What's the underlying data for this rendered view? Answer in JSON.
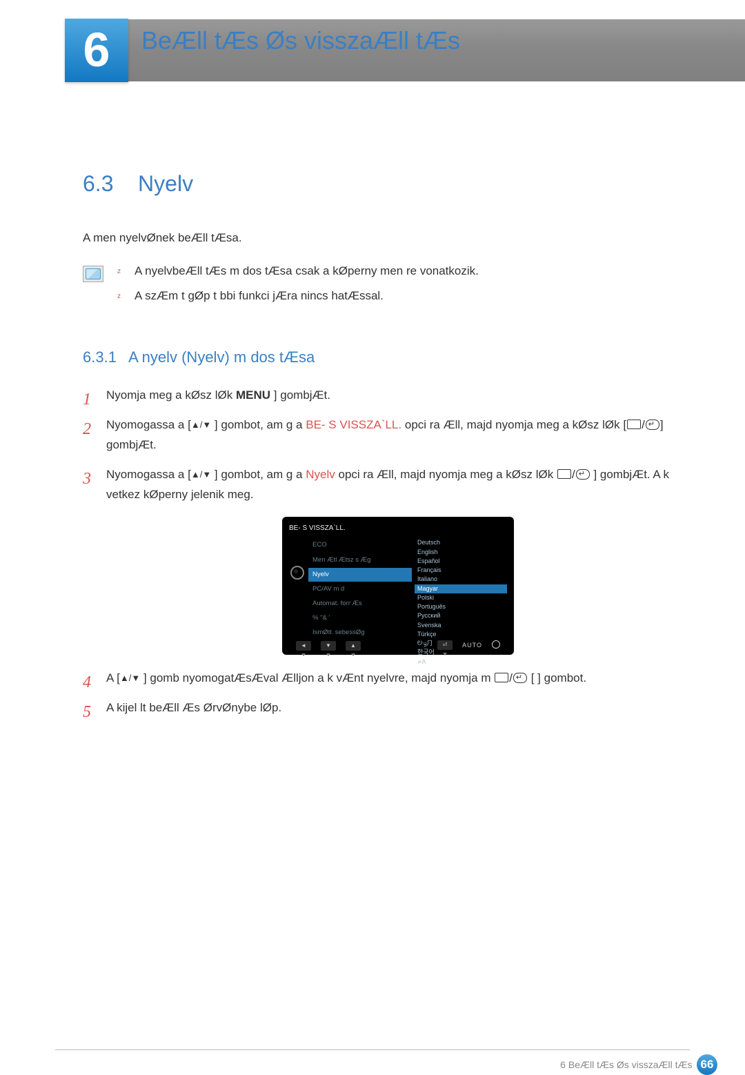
{
  "chapter": {
    "number": "6",
    "title": "BeÆll tÆs Øs visszaÆll tÆs"
  },
  "section": {
    "number": "6.3",
    "title": "Nyelv",
    "intro": "A men  nyelvØnek beÆll tÆsa.",
    "notes": [
      "A nyelvbeÆll tÆs m dos tÆsa csak a kØperny men re vonatkozik.",
      "A szÆm t gØp t bbi funkci jÆra nincs hatÆssal."
    ]
  },
  "subsection": {
    "number": "6.3.1",
    "title": "A nyelv (Nyelv) m dos tÆsa"
  },
  "steps": {
    "s1_a": "Nyomja meg a kØsz lØk",
    "s1_menu": "MENU",
    "s1_b": " ] gombjÆt.",
    "s2_a": "Nyomogassa a [",
    "s2_b": " ] gombot, am g a",
    "s2_red": "BE- S VISSZA`LL.",
    "s2_c": " opci ra Æll, majd nyomja meg a kØsz lØk [",
    "s2_d": "] gombjÆt.",
    "s3_a": "Nyomogassa a [",
    "s3_b": " ] gombot, am g a",
    "s3_red": "Nyelv",
    "s3_c": " opci ra Æll, majd nyomja meg a kØsz lØk",
    "s3_d": "] gombjÆt. A k vetkez  kØperny  jelenik meg.",
    "s4_a": "A [",
    "s4_b": " ] gomb nyomogatÆsÆval Ælljon a k vÆnt nyelvre, majd nyomja m",
    "s4_c": "[         ] gombot.",
    "s5": "A kijel lt beÆll Æs ØrvØnybe lØp."
  },
  "osd": {
    "title": "BE- S VISSZA`LL.",
    "left": [
      "ECO",
      "Men Ætl Ætsz s Æg",
      "Nyelv",
      "PC/AV m d",
      "Automat. forr Æs",
      "% \"&   '",
      "IsmØtl. sebessØg"
    ],
    "languages": [
      "Deutsch",
      "English",
      "Español",
      "Français",
      "Italiano",
      "Magyar",
      "Polski",
      "Português",
      "Русский",
      "Svenska",
      "Türkçe",
      "ᣣᧄ⺆",
      "한국어",
      "∝A"
    ],
    "selected_left_index": 2,
    "selected_lang_index": 5,
    "auto_label": "AUTO"
  },
  "footer": {
    "text": "6 BeÆll tÆs Øs visszaÆll tÆs",
    "page": "66"
  }
}
